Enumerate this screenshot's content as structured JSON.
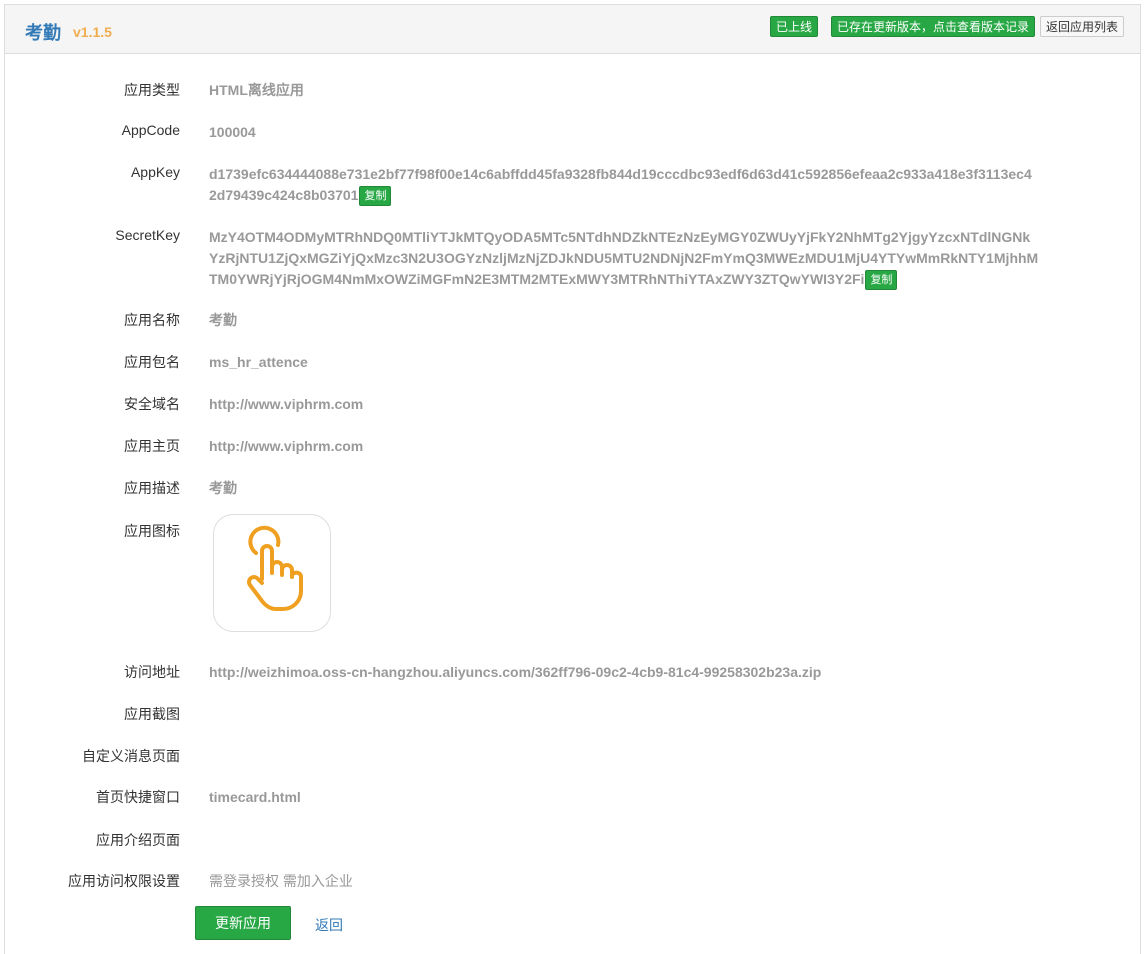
{
  "header": {
    "title": "考勤",
    "version": "v1.1.5",
    "online_badge": "已上线",
    "update_badge": "已存在更新版本，点击查看版本记录",
    "back_list_button": "返回应用列表"
  },
  "fields": {
    "app_type": {
      "label": "应用类型",
      "value": "HTML离线应用"
    },
    "app_code": {
      "label": "AppCode",
      "value": "100004"
    },
    "app_key": {
      "label": "AppKey",
      "value": "d1739efc634444088e731e2bf77f98f00e14c6abffdd45fa9328fb844d19cccdbc93edf6d63d41c592856efeaa2c933a418e3f3113ec42d79439c424c8b03701"
    },
    "secret_key": {
      "label": "SecretKey",
      "value": "MzY4OTM4ODMyMTRhNDQ0MTliYTJkMTQyODA5MTc5NTdhNDZkNTEzNzEyMGY0ZWUyYjFkY2NhMTg2YjgyYzcxNTdlNGNkYzRjNTU1ZjQxMGZiYjQxMzc3N2U3OGYzNzljMzNjZDJkNDU5MTU2NDNjN2FmYmQ3MWEzMDU1MjU4YTYwMmRkNTY1MjhhMTM0YWRjYjRjOGM4NmMxOWZiMGFmN2E3MTM2MTExMWY3MTRhNThiYTAxZWY3ZTQwYWI3Y2Fi"
    },
    "app_name": {
      "label": "应用名称",
      "value": "考勤"
    },
    "package_name": {
      "label": "应用包名",
      "value": "ms_hr_attence"
    },
    "safe_domain": {
      "label": "安全域名",
      "value": "http://www.viphrm.com"
    },
    "homepage": {
      "label": "应用主页",
      "value": "http://www.viphrm.com"
    },
    "description": {
      "label": "应用描述",
      "value": "考勤"
    },
    "icon": {
      "label": "应用图标"
    },
    "access_url": {
      "label": "访问地址",
      "value": "http://weizhimoa.oss-cn-hangzhou.aliyuncs.com/362ff796-09c2-4cb9-81c4-99258302b23a.zip"
    },
    "screenshots": {
      "label": "应用截图",
      "value": ""
    },
    "custom_msg_page": {
      "label": "自定义消息页面",
      "value": ""
    },
    "home_shortcut": {
      "label": "首页快捷窗口",
      "value": "timecard.html"
    },
    "intro_page": {
      "label": "应用介绍页面",
      "value": ""
    },
    "access_perm": {
      "label": "应用访问权限设置",
      "value": "需登录授权 需加入企业"
    }
  },
  "copy_label": "复制",
  "actions": {
    "update_button": "更新应用",
    "back_link": "返回"
  },
  "colors": {
    "accent_green": "#28a745",
    "title_blue": "#337ab7",
    "version_orange": "#f0ad4e",
    "icon_orange": "#f0a020"
  },
  "icon_name": "pointing-hand-icon"
}
